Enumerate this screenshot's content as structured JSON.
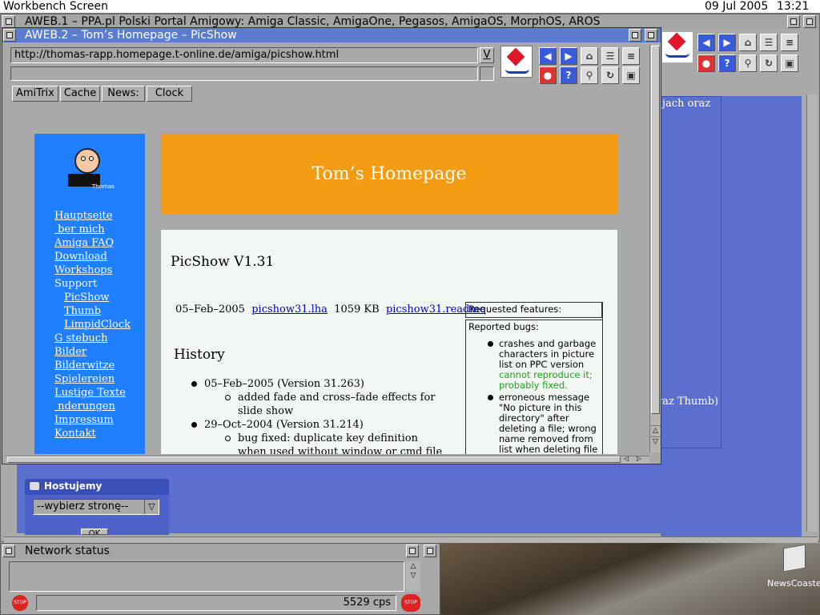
{
  "screen": {
    "title": "Workbench Screen",
    "date": "09 Jul 2005",
    "time": "13:21"
  },
  "aweb1": {
    "title": "AWEB.1 – PPA.pl Polski Portal Amigowy: Amiga Classic, AmigaOne, Pegasos, AmigaOS, MorphOS, AROS",
    "frag1": "jach oraz",
    "frag2": "raz Thumb)"
  },
  "aweb2": {
    "title": "AWEB.2 – Tom’s Homepage – PicShow",
    "url": "http://thomas-rapp.homepage.t-online.de/amiga/picshow.html",
    "url_dropdown": "V",
    "hotlist": [
      "AmiTrix",
      "Cache",
      "News:",
      "Clock"
    ]
  },
  "page": {
    "banner": "Tom’s Homepage",
    "logo_caption": "Thomas",
    "nav": [
      {
        "label": "Hauptseite",
        "link": true,
        "indent": false
      },
      {
        "label": " ber mich",
        "link": true,
        "indent": false
      },
      {
        "label": "Amiga FAQ",
        "link": true,
        "indent": false
      },
      {
        "label": "Download",
        "link": true,
        "indent": false
      },
      {
        "label": "Workshops",
        "link": true,
        "indent": false
      },
      {
        "label": "Support",
        "link": false,
        "indent": false
      },
      {
        "label": "PicShow",
        "link": true,
        "indent": true
      },
      {
        "label": "Thumb",
        "link": true,
        "indent": true
      },
      {
        "label": "LimpidClock",
        "link": true,
        "indent": true
      },
      {
        "label": "G stebuch",
        "link": true,
        "indent": false
      },
      {
        "label": "Bilder",
        "link": true,
        "indent": false
      },
      {
        "label": "Bilderwitze",
        "link": true,
        "indent": false
      },
      {
        "label": "Spielereien",
        "link": true,
        "indent": false
      },
      {
        "label": "Lustige Texte",
        "link": true,
        "indent": false
      },
      {
        "label": " nderungen",
        "link": true,
        "indent": false
      },
      {
        "label": "Impressum",
        "link": true,
        "indent": false
      },
      {
        "label": "Kontakt",
        "link": true,
        "indent": false
      }
    ],
    "heading": "PicShow V1.31",
    "release_date": "05–Feb–2005",
    "download_link": "picshow31.lha",
    "size": "1059 KB",
    "readme_link": "picshow31.readme",
    "history_heading": "History",
    "history": [
      {
        "version": "05–Feb–2005 (Version 31.263)",
        "items": [
          "added fade and cross–fade effects for slide show"
        ]
      },
      {
        "version": "29–Oct–2004 (Version 31.214)",
        "items": [
          "bug fixed: duplicate key definition when used without window or cmd file"
        ]
      }
    ],
    "requested_label": "Requested features:",
    "reported_label": "Reported bugs:",
    "bugs": [
      {
        "text": "crashes and garbage characters in picture list on PPC version",
        "note": "cannot reproduce it; probably fixed."
      },
      {
        "text": "erroneous message \"No picture in this directory\" after deleting a file; wrong name removed from list when deleting file",
        "note": ""
      }
    ]
  },
  "hostujemy": {
    "title": "Hostujemy",
    "select": "--wybierz stronę--",
    "ok": "OK"
  },
  "network": {
    "title": "Network status",
    "cps": "5529 cps"
  },
  "desktop_icon": {
    "label": "NewsCoaster"
  },
  "colors": {
    "window_bg": "#a9a9a9",
    "sidebar": "#1f7fff",
    "banner": "#f39b12",
    "ppa_bg": "#5b6fcf",
    "link": "#0000cc",
    "green": "#1aa51a"
  }
}
